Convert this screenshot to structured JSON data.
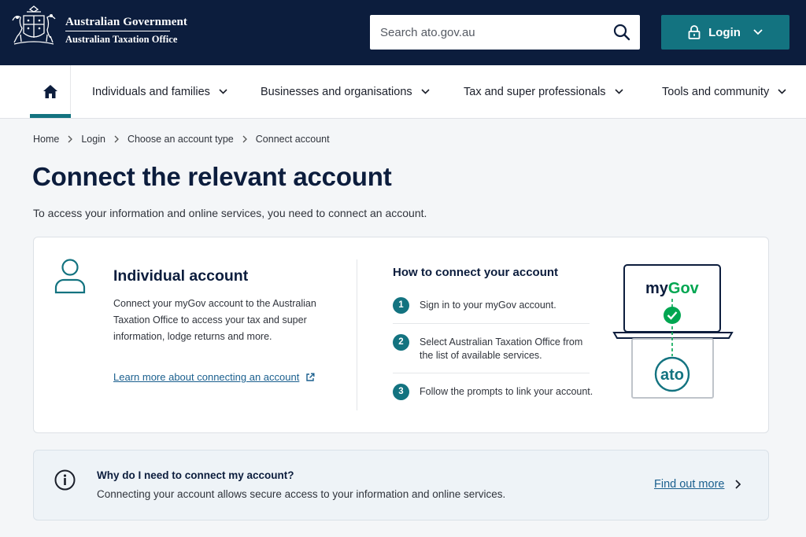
{
  "header": {
    "gov_line1": "Australian Government",
    "gov_line2": "Australian Taxation Office",
    "search_placeholder": "Search ato.gov.au",
    "login_label": "Login"
  },
  "nav": {
    "items": [
      {
        "label": "Individuals and families"
      },
      {
        "label": "Businesses and organisations"
      },
      {
        "label": "Tax and super professionals"
      },
      {
        "label": "Tools and community"
      }
    ]
  },
  "breadcrumb": [
    "Home",
    "Login",
    "Choose an account type",
    "Connect account"
  ],
  "page": {
    "title": "Connect the relevant account",
    "intro": "To access your information and online services, you need to connect an account."
  },
  "card": {
    "title": "Individual account",
    "description": "Connect your myGov account to the Australian Taxation Office to access your tax and super information, lodge returns and more.",
    "link_label": "Learn more about connecting an account",
    "how_title": "How to connect your account",
    "steps": [
      {
        "num": "1",
        "text": "Sign in to your myGov account."
      },
      {
        "num": "2",
        "text": "Select Australian Taxation Office from the list of available services."
      },
      {
        "num": "3",
        "text": "Follow the prompts to link your account."
      }
    ],
    "illustration": {
      "top_label": "myGov",
      "bottom_label": "ato"
    }
  },
  "info": {
    "title": "Why do I need to connect my account?",
    "text": "Connecting your account allows secure access to your information and online services.",
    "link_label": "Find out more"
  },
  "colors": {
    "navy": "#0c1d3d",
    "teal": "#137380",
    "link": "#1a5f8e",
    "mygov_green": "#00a651"
  }
}
